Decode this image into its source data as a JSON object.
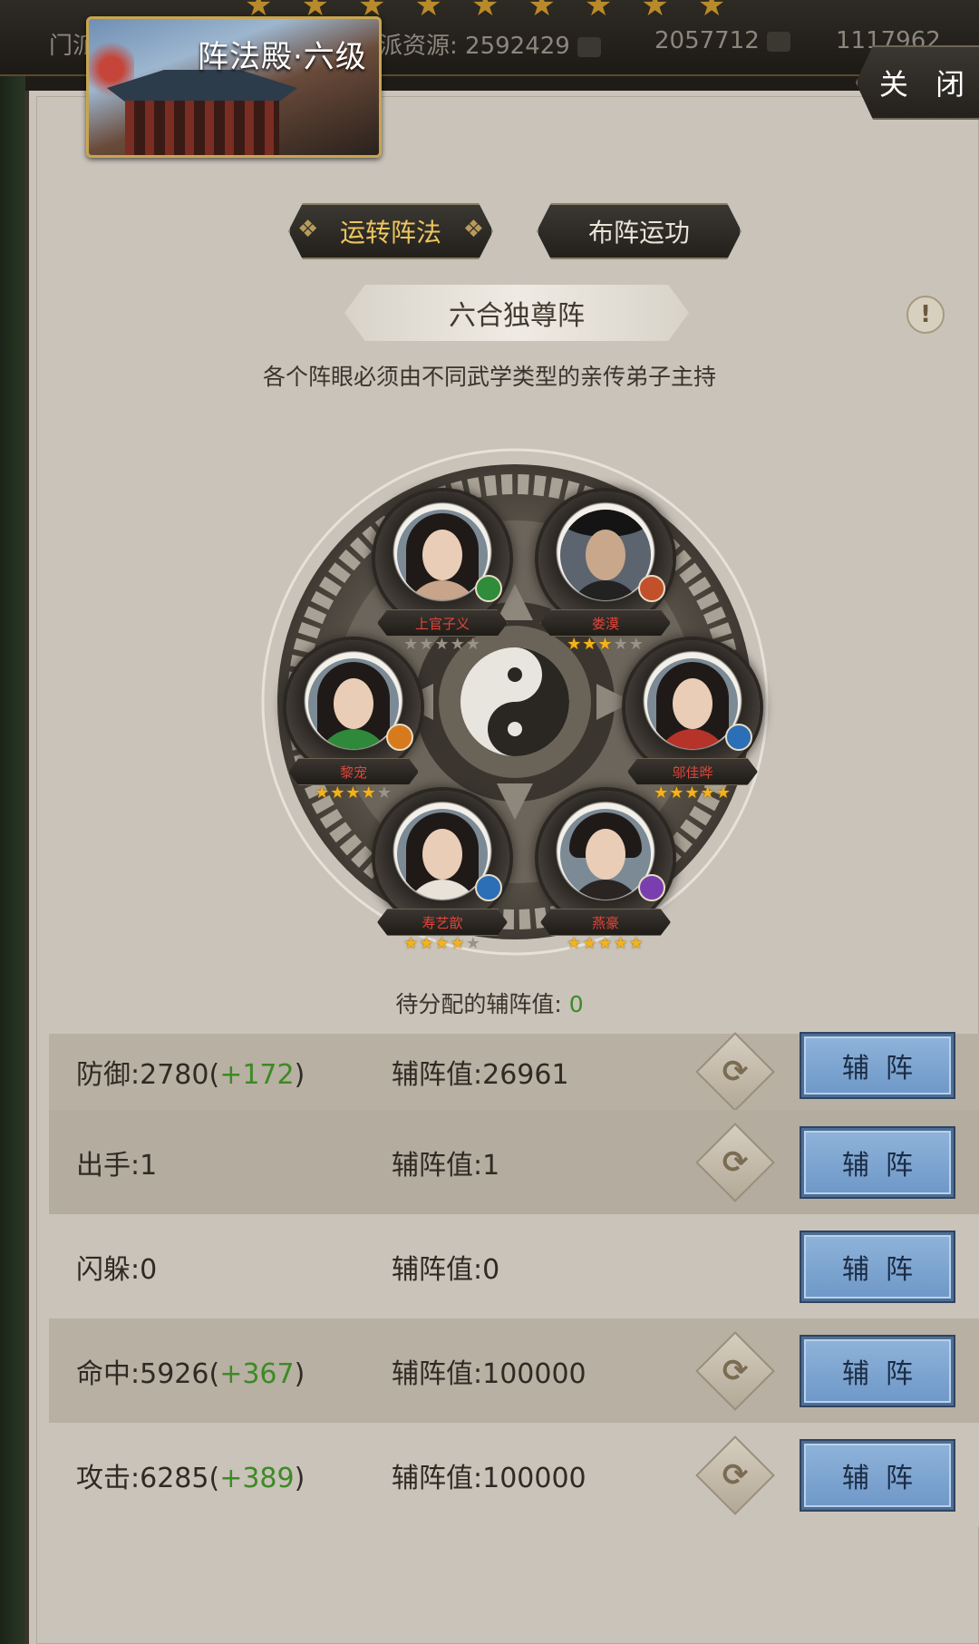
{
  "resources": [
    {
      "label": "门派",
      "value": ""
    },
    {
      "label": "派资源:",
      "value": "2592429"
    },
    {
      "label": "",
      "value": "2057712"
    },
    {
      "label": "",
      "value": "1117962"
    }
  ],
  "title": "阵法殿·六级",
  "close_label": "关 闭",
  "tabs": [
    {
      "label": "运转阵法",
      "active": true
    },
    {
      "label": "布阵运功",
      "active": false
    }
  ],
  "formation_name": "六合独尊阵",
  "formation_hint": "各个阵眼必须由不同武学类型的亲传弟子主持",
  "disciples": [
    {
      "name": "上官子义",
      "stars": 0,
      "max_stars": 5,
      "element_color": "#2e8c3a"
    },
    {
      "name": "娄漠",
      "stars": 3,
      "max_stars": 5,
      "element_color": "#c2502a"
    },
    {
      "name": "黎宠",
      "stars": 4,
      "max_stars": 5,
      "element_color": "#d77a1e"
    },
    {
      "name": "邬佳晔",
      "stars": 5,
      "max_stars": 5,
      "element_color": "#2c6fb6"
    },
    {
      "name": "寿艺歆",
      "stars": 4,
      "max_stars": 5,
      "element_color": "#2c6fb6"
    },
    {
      "name": "燕豪",
      "stars": 5,
      "max_stars": 5,
      "element_color": "#7a3fae"
    }
  ],
  "pending_label": "待分配的辅阵值:",
  "pending_value": "0",
  "stats": [
    {
      "name": "防御:",
      "base": "2780",
      "bonus": "+172",
      "aux_label": "辅阵值:",
      "aux_value": "26961",
      "swap": true,
      "button": "辅阵"
    },
    {
      "name": "出手:",
      "base": "1",
      "bonus": "",
      "aux_label": "辅阵值:",
      "aux_value": "1",
      "swap": true,
      "button": "辅阵"
    },
    {
      "name": "闪躲:",
      "base": "0",
      "bonus": "",
      "aux_label": "辅阵值:",
      "aux_value": "0",
      "swap": false,
      "button": "辅阵"
    },
    {
      "name": "命中:",
      "base": "5926",
      "bonus": "+367",
      "aux_label": "辅阵值:",
      "aux_value": "100000",
      "swap": true,
      "button": "辅阵"
    },
    {
      "name": "攻击:",
      "base": "6285",
      "bonus": "+389",
      "aux_label": "辅阵值:",
      "aux_value": "100000",
      "swap": true,
      "button": "辅阵"
    }
  ]
}
